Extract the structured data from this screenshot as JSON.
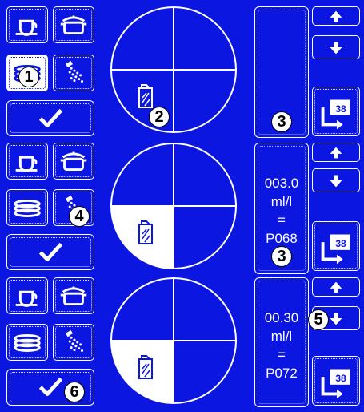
{
  "colors": {
    "background": "#0b16e0",
    "foreground": "#ffffff"
  },
  "callouts": [
    "1",
    "2",
    "3",
    "3",
    "4",
    "5",
    "6"
  ],
  "sections": [
    {
      "row1": {
        "left_icon": "cup-icon",
        "right_icon": "pot-icon"
      },
      "row2": {
        "left_icon": "plates-icon",
        "right_icon": "cutlery-icon",
        "selected": [
          "left"
        ]
      },
      "confirm_icon": "checkmark-icon",
      "pie_icon": "detergent-canister-icon",
      "pie_filled_quadrant": "none",
      "panel": {
        "value": "",
        "unit": "",
        "equals": "",
        "code": ""
      },
      "side": {
        "up_icon": "arrow-up-icon",
        "down_icon": "arrow-down-icon",
        "program_number": "38"
      }
    },
    {
      "row1": {
        "left_icon": "cup-icon",
        "right_icon": "pot-icon"
      },
      "row2": {
        "left_icon": "plates-icon",
        "right_icon": "cutlery-icon",
        "selected": []
      },
      "confirm_icon": "checkmark-icon",
      "pie_icon": "detergent-canister-icon",
      "pie_filled_quadrant": "bottom-left",
      "panel": {
        "value": "003.0",
        "unit": "ml/l",
        "equals": "=",
        "code": "P068"
      },
      "side": {
        "up_icon": "arrow-up-icon",
        "down_icon": "arrow-down-icon",
        "program_number": "38"
      }
    },
    {
      "row1": {
        "left_icon": "cup-icon",
        "right_icon": "pot-icon"
      },
      "row2": {
        "left_icon": "plates-icon",
        "right_icon": "cutlery-icon",
        "selected": []
      },
      "confirm_icon": "checkmark-icon",
      "pie_icon": "detergent-canister-icon",
      "pie_filled_quadrant": "bottom-left",
      "panel": {
        "value": "00.30",
        "unit": "ml/l",
        "equals": "=",
        "code": "P072"
      },
      "side": {
        "up_icon": "arrow-up-icon",
        "down_icon": "arrow-down-icon",
        "program_number": "38"
      }
    }
  ]
}
